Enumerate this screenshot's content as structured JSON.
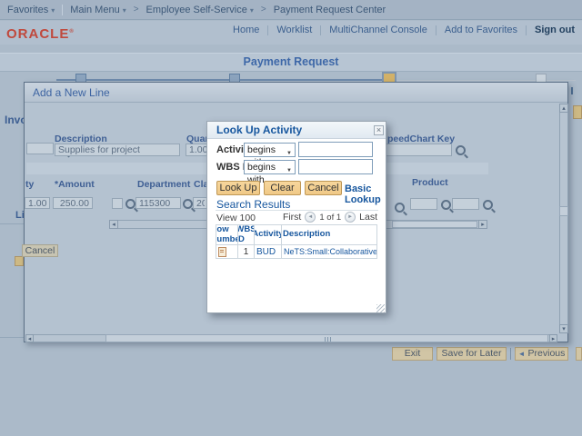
{
  "colors": {
    "oracle-red": "#c0493d",
    "link-blue": "#16569e",
    "dim-blue": "#3f5f94",
    "button-tan": "#f7d79c",
    "button-tan-border": "#bf9755"
  },
  "chrome": {
    "favorites": "Favorites",
    "main_menu": "Main Menu",
    "crumb_sep": ">",
    "employee_self_service": "Employee Self-Service",
    "payment_request_center": "Payment Request Center",
    "home": "Home",
    "worklist": "Worklist",
    "multichannel_console": "MultiChannel Console",
    "add_to_favorites": "Add to Favorites",
    "sign_out": "Sign out",
    "brand": "ORACLE",
    "brand_mark": "®"
  },
  "page": {
    "title": "Payment Request",
    "invoice_label_partial": "Invo",
    "lines_label_partial": "Li",
    "exit": "Exit",
    "save_for_later": "Save for Later",
    "previous": "Previous"
  },
  "add_line": {
    "title": "Add a New Line",
    "description_label": "Description",
    "description_value": "Supplies for project",
    "quantity_label_partial": "Quant",
    "quantity_value_partial": "1.00",
    "speedchart_label_partial": "peedChart Key",
    "grid": {
      "quantity_header_partial": "ty",
      "amount_header": "*Amount",
      "department_header": "Department",
      "class_header_partial": "Cla",
      "product_header": "Product",
      "row": {
        "quantity": "1.0000",
        "amount": "250.00",
        "department": "115300",
        "class_partial": "20"
      }
    },
    "cancel": "Cancel"
  },
  "lookup": {
    "title": "Look Up Activity",
    "activity_label": "Activity:",
    "wbs_id_label": "WBS ID:",
    "activity_operator": "begins with",
    "wbs_id_operator": "begins with",
    "look_up": "Look Up",
    "clear": "Clear",
    "cancel": "Cancel",
    "basic_lookup": "Basic Lookup",
    "search_results": "Search Results",
    "view_100": "View 100",
    "first": "First",
    "page_counter": "1 of 1",
    "last": "Last",
    "table": {
      "headers": [
        "Row Number",
        "WBS ID",
        "Activity",
        "Description"
      ],
      "rows": [
        {
          "wbs_id": "1",
          "activity": "BUD",
          "description": "NeTS:Small:Collaborative:Infra"
        }
      ]
    }
  }
}
